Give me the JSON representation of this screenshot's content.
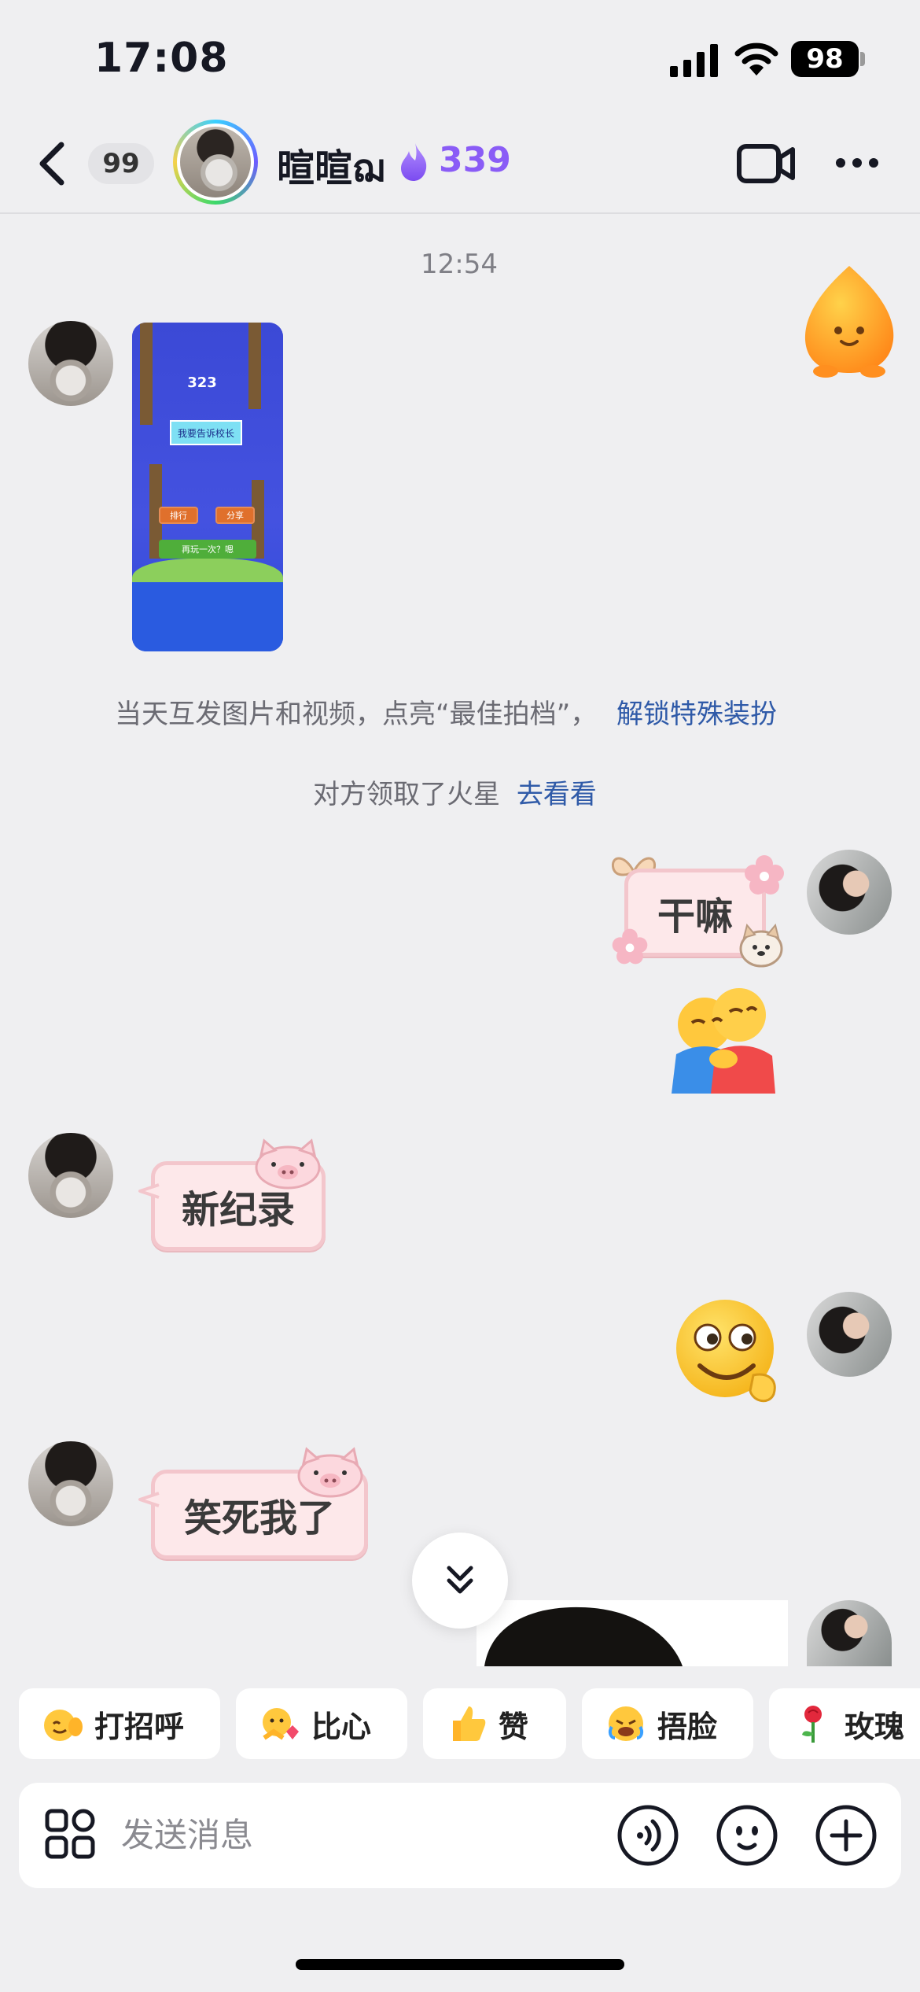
{
  "status_bar": {
    "time": "17:08",
    "battery": "98"
  },
  "header": {
    "unread_count": "99",
    "peer_name": "暄暄ฌ",
    "streak_count": "339"
  },
  "chat": {
    "timestamp": "12:54",
    "system_notices": [
      {
        "text": "当天互发图片和视频，点亮“最佳拍档”，",
        "link": "解锁特殊装扮"
      },
      {
        "text": "对方领取了火星",
        "link": "去看看"
      }
    ],
    "game_screenshot": {
      "score": "323",
      "title_text": "我要告诉校长",
      "buttons": [
        "排行",
        "分享"
      ],
      "play_text": "再玩一次？嗯"
    },
    "stickers": {
      "me_1": "干嘛",
      "peer_1": "新纪录",
      "peer_2": "笑死我了"
    }
  },
  "quick_replies": [
    {
      "label": "打招呼",
      "icon": "wave-emoji-icon"
    },
    {
      "label": "比心",
      "icon": "heart-hands-emoji-icon"
    },
    {
      "label": "赞",
      "icon": "thumbs-up-emoji-icon"
    },
    {
      "label": "捂脸",
      "icon": "facepalm-emoji-icon"
    },
    {
      "label": "玫瑰",
      "icon": "rose-emoji-icon"
    }
  ],
  "input": {
    "placeholder": "发送消息"
  }
}
